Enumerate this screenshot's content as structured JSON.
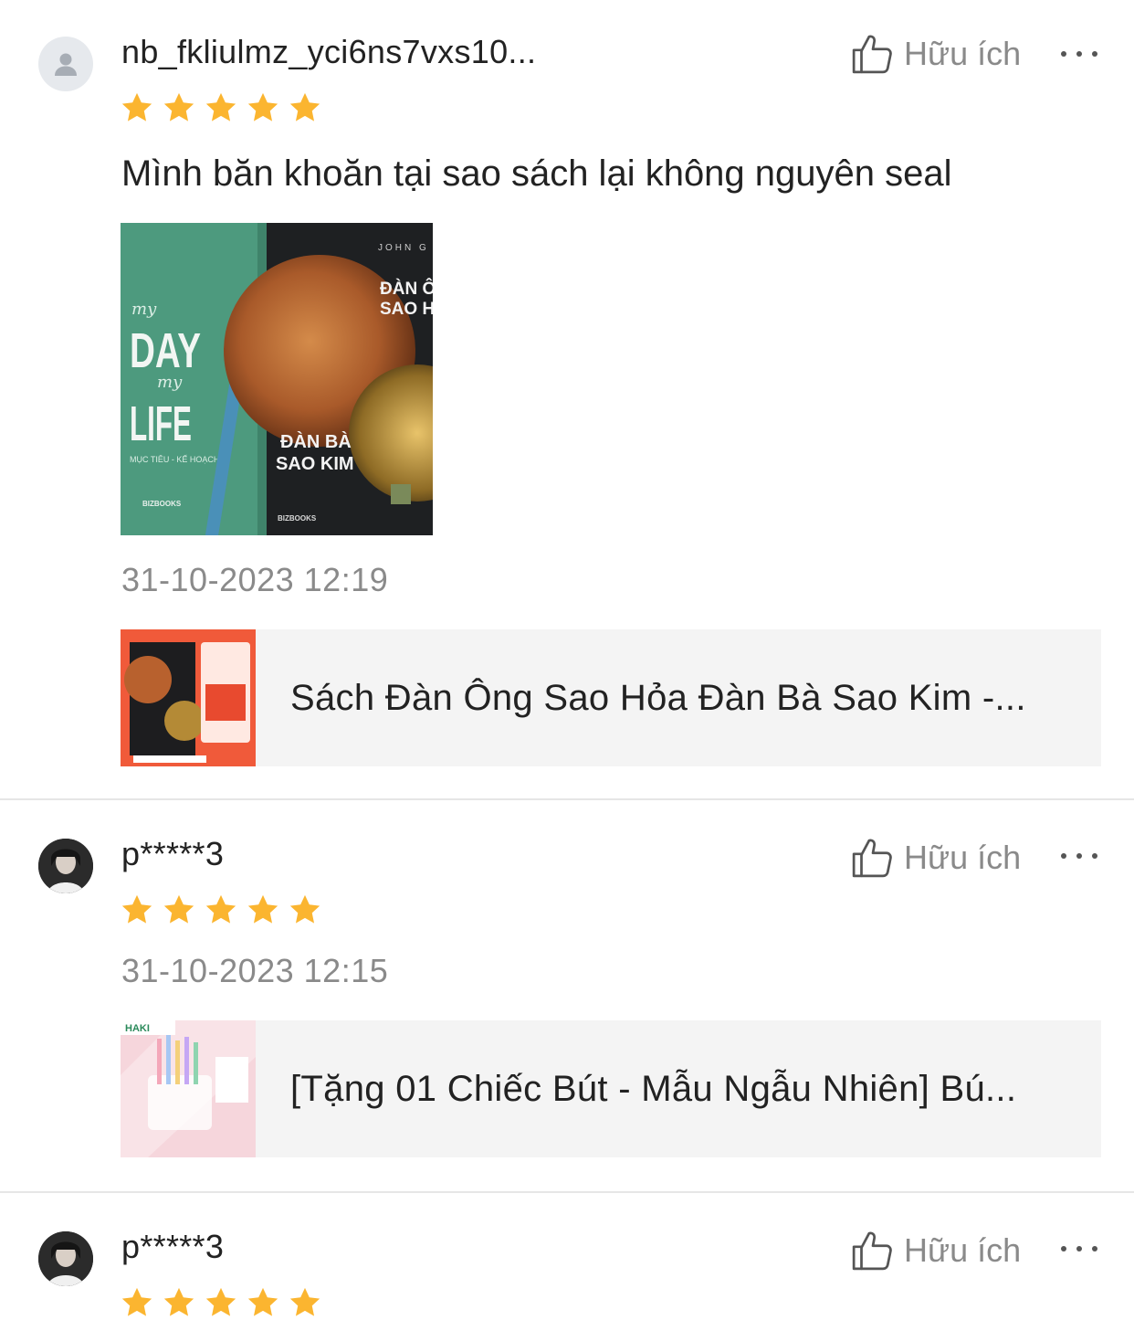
{
  "reviews": [
    {
      "username": "nb_fkliulmz_yci6ns7vxs10...",
      "helpful_label": "Hữu ích",
      "rating": 5,
      "comment": "Mình băn khoăn tại sao sách lại không nguyên seal",
      "photo": {
        "book1_title_a": "DAY",
        "book1_title_b": "LIFE",
        "book1_script_a": "my",
        "book1_script_b": "my",
        "book1_sub": "MỤC TIÊU - KẾ HOẠCH",
        "book2_title_a": "ĐÀN BÀ",
        "book2_title_b": "SAO KIM",
        "book2_side_a": "ĐÀN Ô",
        "book2_side_b": "SAO H",
        "book2_author": "JOHN G",
        "publisher": "BIZBOOKS"
      },
      "timestamp": "31-10-2023 12:19",
      "product_name": "Sách Đàn Ông Sao Hỏa Đàn Bà Sao Kim -..."
    },
    {
      "username": "p*****3",
      "helpful_label": "Hữu ích",
      "rating": 5,
      "timestamp": "31-10-2023 12:15",
      "product_name": "[Tặng  01 Chiếc Bút - Mẫu Ngẫu Nhiên] Bú...",
      "thumb_brand": "HAKI"
    },
    {
      "username": "p*****3",
      "helpful_label": "Hữu ích",
      "rating": 5
    }
  ],
  "colors": {
    "star": "#fbb530",
    "muted_text": "#8a8a8a",
    "product_bg": "#f4f4f4",
    "divider": "#e6e6e6"
  },
  "icons": {
    "helpful": "thumbs-up-icon",
    "more": "more-icon",
    "star": "star-icon",
    "default_avatar": "user-icon"
  }
}
